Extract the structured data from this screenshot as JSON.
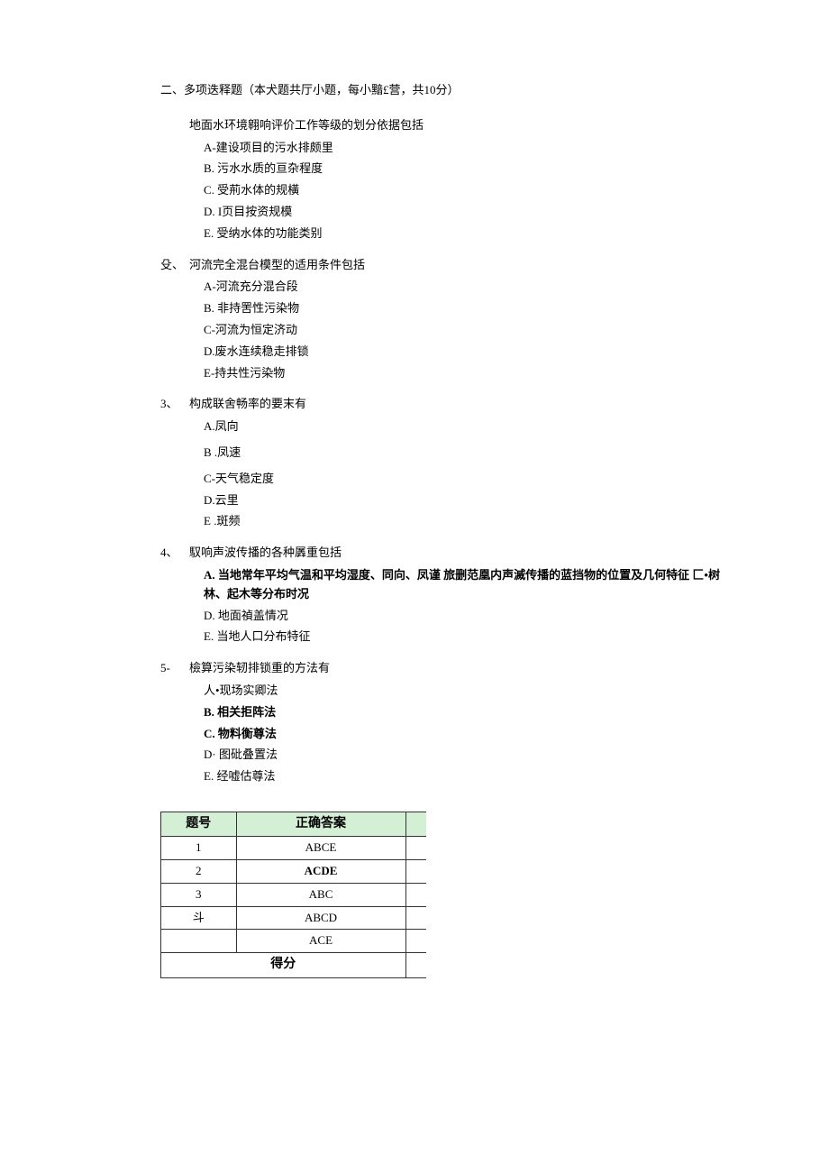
{
  "section_title": "二、多项迭释题（本犬题共厅小题，每小黯£营，共10分）",
  "questions": [
    {
      "num": "",
      "stem": "地面水环境翱响评价工作等级的划分依据包括",
      "stem_indent": true,
      "options": [
        {
          "text": "A-建设项目的污水排颇里",
          "bold": false
        },
        {
          "text": "B.   污水水质的亘杂程度",
          "bold": false
        },
        {
          "text": "C.   受荊水体的规橫",
          "bold": false
        },
        {
          "text": "D.   I页目按资规模",
          "bold": false
        },
        {
          "text": "E.   受纳水体的功能类别",
          "bold": false
        }
      ]
    },
    {
      "num": "殳、",
      "stem": "河流完全混台模型的适用条件包括",
      "stem_indent": false,
      "options": [
        {
          "text": "A-河流充分混合段",
          "bold": false
        },
        {
          "text": "B.   非持罟性污染物",
          "bold": false
        },
        {
          "text": "C-河流为恒定济动",
          "bold": false
        },
        {
          "text": "D.废水连续稳走排锁",
          "bold": false
        },
        {
          "text": "E-持共性污染物",
          "bold": false
        }
      ]
    },
    {
      "num": "3、",
      "stem": "构成联舍畅率的要末有",
      "stem_indent": false,
      "options": [
        {
          "text": "A.凤向",
          "bold": false
        },
        {
          "text": "B .凤速",
          "bold": false,
          "gap": true
        },
        {
          "text": "C-天气稳定度",
          "bold": false,
          "gap": true
        },
        {
          "text": "D.云里",
          "bold": false
        },
        {
          "text": "E .斑频",
          "bold": false
        }
      ]
    },
    {
      "num": "4、",
      "stem": "馭响声波传播的各种羼重包括",
      "stem_indent": false,
      "options": [
        {
          "text": "A.   当地常年平均气温和平均湿度、同向、凤谨 旅删范凰内声滅传播的蓝挡物的位置及几何特征 匚•树林、起木等分布时况",
          "bold": true,
          "para": true
        },
        {
          "text": "D.   地面禎盖情况",
          "bold": false
        },
        {
          "text": "E.   当地人口分布特征",
          "bold": false
        }
      ]
    },
    {
      "num": "5-",
      "stem": "檢算污染轫排锁重的方法有",
      "stem_indent": false,
      "options": [
        {
          "text": "人•现场实卿法",
          "bold": false
        },
        {
          "text": "B.   相关拒阵法",
          "bold": true
        },
        {
          "text": "C.   物料衡尊法",
          "bold": true
        },
        {
          "text": "D· 图砒叠置法",
          "bold": false
        },
        {
          "text": "E.   经嘘估尊法",
          "bold": false
        }
      ]
    }
  ],
  "table": {
    "headers": [
      "题号",
      "正确答案"
    ],
    "rows": [
      {
        "num": "1",
        "ans": "ABCE",
        "bold": false
      },
      {
        "num": "2",
        "ans": "ACDE",
        "bold": true
      },
      {
        "num": "3",
        "ans": "ABC",
        "bold": false
      },
      {
        "num": "斗",
        "ans": "ABCD",
        "bold": false
      },
      {
        "num": "",
        "ans": "ACE",
        "bold": false
      }
    ],
    "score_label": "得分"
  }
}
